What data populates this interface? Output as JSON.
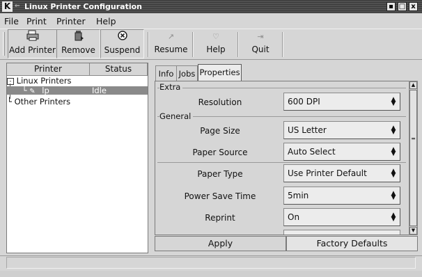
{
  "window": {
    "logo": "K",
    "title": "Linux Printer Configuration",
    "controls": {
      "minimize": "▪",
      "maximize": "□",
      "close": "x"
    }
  },
  "menu": [
    "File",
    "Print",
    "Printer",
    "Help"
  ],
  "toolbar": {
    "add_printer": "Add Printer",
    "remove": "Remove",
    "suspend": "Suspend",
    "resume": "Resume",
    "help": "Help",
    "quit": "Quit",
    "icons": {
      "add_printer": "printer-icon",
      "remove": "trash-icon",
      "suspend": "suspend-icon",
      "resume": "resume-arrow-icon",
      "help": "help-icon",
      "quit": "quit-arrow-icon"
    }
  },
  "tree": {
    "headers": {
      "printer": "Printer",
      "status": "Status"
    },
    "group_linux": "Linux Printers",
    "printer_name": "lp",
    "printer_status": "Idle",
    "group_other": "Other Printers"
  },
  "tabs": {
    "info": "Info",
    "jobs": "Jobs",
    "properties": "Properties",
    "active": "Properties"
  },
  "props": {
    "group_extra": "Extra",
    "group_general": "General",
    "rows": [
      {
        "label": "Resolution",
        "value": "600 DPI"
      },
      {
        "label": "Page Size",
        "value": "US Letter"
      },
      {
        "label": "Paper Source",
        "value": "Auto Select"
      },
      {
        "label": "Paper Type",
        "value": "Use Printer Default"
      },
      {
        "label": "Power Save Time",
        "value": "5min"
      },
      {
        "label": "Reprint",
        "value": "On"
      }
    ]
  },
  "buttons": {
    "apply": "Apply",
    "factory": "Factory Defaults"
  },
  "colors": {
    "selection": "#8a8a8a",
    "titlebar": "#454545",
    "background": "#d6d6d6"
  }
}
